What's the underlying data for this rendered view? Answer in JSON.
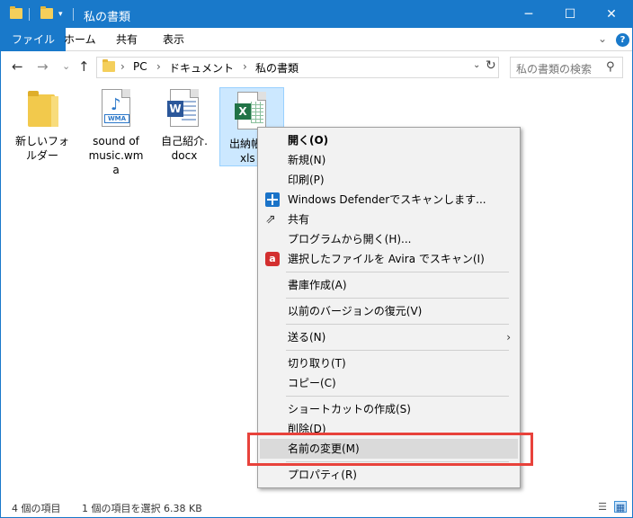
{
  "window": {
    "title": "私の書類",
    "minimize": "─",
    "maximize": "☐",
    "close": "✕"
  },
  "ribbon": {
    "tabs": [
      {
        "label": "ファイル"
      },
      {
        "label": "ホーム"
      },
      {
        "label": "共有"
      },
      {
        "label": "表示"
      }
    ],
    "expand_glyph": "⌄",
    "help_glyph": "?"
  },
  "nav": {
    "back": "←",
    "forward": "→",
    "recent": "⌄",
    "up": "↑",
    "breadcrumbs": [
      "PC",
      "ドキュメント",
      "私の書類"
    ],
    "separator": "›",
    "dropdown": "⌄",
    "refresh": "↻"
  },
  "search": {
    "placeholder": "私の書類の検索",
    "icon_glyph": "⚲"
  },
  "files": [
    {
      "name_lines": [
        "新しいフォ",
        "ルダー"
      ],
      "icon": "folder-icon"
    },
    {
      "name_lines": [
        "sound of",
        "music.wm",
        "a"
      ],
      "icon": "wma-file-icon",
      "badge": "WMA"
    },
    {
      "name_lines": [
        "自己紹介.",
        "docx"
      ],
      "icon": "word-file-icon",
      "badge": "W"
    },
    {
      "name_lines": [
        "出納帳",
        "xls"
      ],
      "icon": "excel-file-icon",
      "badge": "X"
    }
  ],
  "context_menu": {
    "items": [
      {
        "label": "開く(O)",
        "bold": true
      },
      {
        "label": "新規(N)"
      },
      {
        "label": "印刷(P)"
      },
      {
        "label": "Windows Defenderでスキャンします...",
        "icon": "windows-defender-icon"
      },
      {
        "label": "共有",
        "icon": "share-icon"
      },
      {
        "label": "プログラムから開く(H)..."
      },
      {
        "label": "選択したファイルを Avira でスキャン(I)",
        "icon": "avira-icon"
      },
      {
        "label": "書庫作成(A)"
      },
      {
        "label": "以前のバージョンの復元(V)"
      },
      {
        "label": "送る(N)",
        "submenu": true
      },
      {
        "label": "切り取り(T)"
      },
      {
        "label": "コピー(C)"
      },
      {
        "label": "ショートカットの作成(S)"
      },
      {
        "label": "削除(D)"
      },
      {
        "label": "名前の変更(M)",
        "highlighted": true
      },
      {
        "label": "プロパティ(R)"
      }
    ],
    "submenu_arrow": "›",
    "avira_glyph": "a",
    "share_glyph": "⇗"
  },
  "status": {
    "item_count": "4 個の項目",
    "selection": "1 個の項目を選択  6.38 KB",
    "details_view_glyph": "☰",
    "large_icons_glyph": "▦"
  },
  "colors": {
    "accent": "#1979ca",
    "highlight_box": "#e8423b",
    "selection": "#cce8ff"
  }
}
